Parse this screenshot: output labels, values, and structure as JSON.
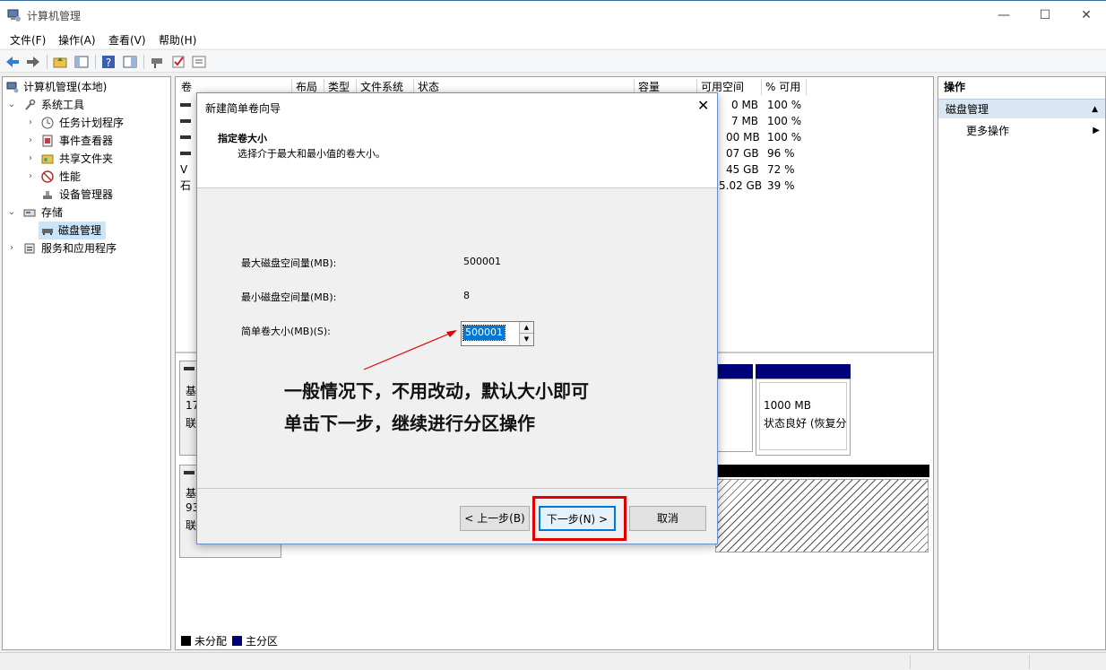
{
  "window": {
    "title": "计算机管理",
    "min": "—",
    "max": "☐",
    "close": "✕"
  },
  "menu": [
    "文件(F)",
    "操作(A)",
    "查看(V)",
    "帮助(H)"
  ],
  "tree": {
    "root": "计算机管理(本地)",
    "system_tools": "系统工具",
    "task_scheduler": "任务计划程序",
    "event_viewer": "事件查看器",
    "shared_folders": "共享文件夹",
    "performance": "性能",
    "device_manager": "设备管理器",
    "storage": "存储",
    "disk_management": "磁盘管理",
    "services_apps": "服务和应用程序"
  },
  "volume_table": {
    "headers": [
      "卷",
      "布局",
      "类型",
      "文件系统",
      "状态",
      "容量",
      "可用空间",
      "% 可用"
    ],
    "rows": [
      {
        "vol": "",
        "free": "0 MB",
        "pct": "100 %"
      },
      {
        "vol": "",
        "free": "7 MB",
        "pct": "100 %"
      },
      {
        "vol": "",
        "free": "00 MB",
        "pct": "100 %"
      },
      {
        "vol": "",
        "free": "07 GB",
        "pct": "96 %"
      },
      {
        "vol": "V",
        "free": "45 GB",
        "pct": "72 %"
      },
      {
        "vol": "石",
        "free": "5.02 GB",
        "pct": "39 %"
      }
    ]
  },
  "disks": [
    {
      "label1": "基",
      "label2": "17",
      "label3": "联"
    },
    {
      "label1": "基",
      "label2": "93",
      "label3": "联"
    }
  ],
  "partition": {
    "size": "1000 MB",
    "status": "状态良好 (恢复分"
  },
  "legend": {
    "unallocated": "未分配",
    "primary": "主分区",
    "unallocated_color": "#000000",
    "primary_color": "#00007b"
  },
  "actions": {
    "header": "操作",
    "section": "磁盘管理",
    "more": "更多操作"
  },
  "dialog": {
    "title": "新建简单卷向导",
    "heading": "指定卷大小",
    "subheading": "选择介于最大和最小值的卷大小。",
    "max_label": "最大磁盘空间量(MB):",
    "max_value": "500001",
    "min_label": "最小磁盘空间量(MB):",
    "min_value": "8",
    "size_label": "简单卷大小(MB)(S):",
    "size_value": "500001",
    "back": "< 上一步(B)",
    "next": "下一步(N) >",
    "cancel": "取消"
  },
  "annotation": {
    "line1": "一般情况下，不用改动，默认大小即可",
    "line2": "单击下一步，继续进行分区操作",
    "color": "#e00000"
  }
}
